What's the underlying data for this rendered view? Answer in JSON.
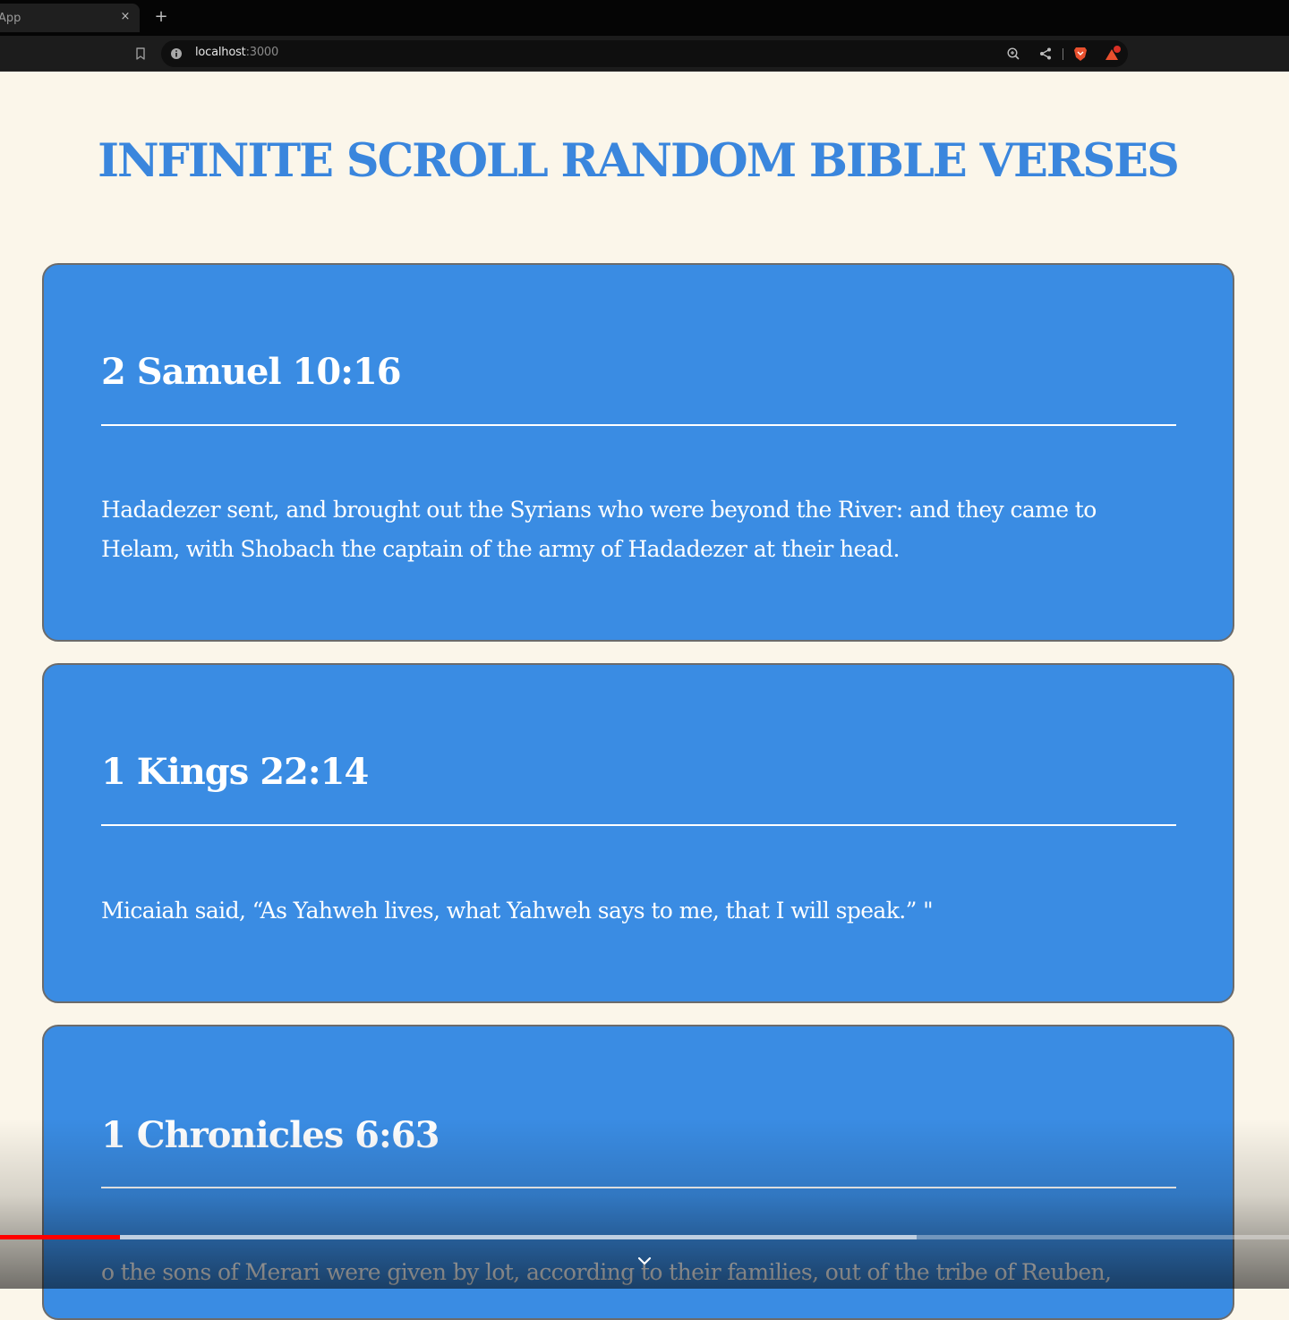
{
  "browser": {
    "tab_title": "App",
    "tab_close": "×",
    "new_tab": "+",
    "url_host": "localhost",
    "url_port": ":3000"
  },
  "page": {
    "title": "INFINITE SCROLL RANDOM BIBLE VERSES",
    "verses": [
      {
        "reference": "2 Samuel 10:16",
        "text": "Hadadezer sent, and brought out the Syrians who were beyond the River: and they came to Helam, with Shobach the captain of the army of Hadadezer at their head."
      },
      {
        "reference": "1 Kings 22:14",
        "text": "Micaiah said, “As Yahweh lives, what Yahweh says to me, that I will speak.” \""
      },
      {
        "reference": "1 Chronicles 6:63",
        "text": "o the sons of Merari were given by lot, according to their families, out of the tribe of Reuben,"
      }
    ]
  },
  "player": {
    "played_fraction": 0.093,
    "buffered_fraction": 0.711
  },
  "colors": {
    "page_bg": "#fbf6ea",
    "accent": "#3a86dd",
    "card_bg": "#3a8ce3",
    "progress_played": "#ff0000"
  }
}
